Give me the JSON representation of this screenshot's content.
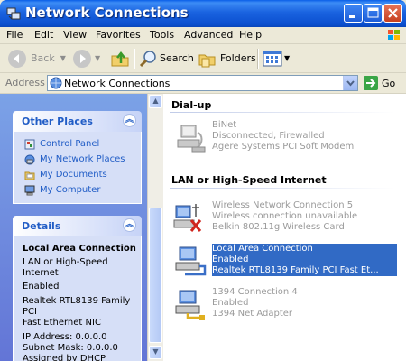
{
  "window": {
    "title": "Network Connections"
  },
  "menu": [
    "File",
    "Edit",
    "View",
    "Favorites",
    "Tools",
    "Advanced",
    "Help"
  ],
  "toolbar": {
    "back_label": "Back",
    "search_label": "Search",
    "folders_label": "Folders"
  },
  "address": {
    "label": "Address",
    "value": "Network Connections",
    "go_label": "Go"
  },
  "other_places": {
    "title": "Other Places",
    "links": [
      "Control Panel",
      "My Network Places",
      "My Documents",
      "My Computer"
    ]
  },
  "details": {
    "title": "Details",
    "name": "Local Area Connection",
    "lines": [
      "LAN or High-Speed Internet",
      "Enabled",
      "Realtek RTL8139 Family PCI",
      "Fast Ethernet NIC"
    ],
    "ip_lines": [
      "IP Address: 0.0.0.0",
      "Subnet Mask: 0.0.0.0",
      "Assigned by DHCP"
    ]
  },
  "groups": {
    "dialup": {
      "title": "Dial-up",
      "items": [
        {
          "name": "BiNet",
          "status": "Disconnected, Firewalled",
          "device": "Agere Systems PCI Soft Modem"
        }
      ]
    },
    "lan": {
      "title": "LAN or High-Speed Internet",
      "items": [
        {
          "name": "Wireless Network Connection 5",
          "status": "Wireless connection unavailable",
          "device": "Belkin 802.11g Wireless Card"
        },
        {
          "name": "Local Area Connection",
          "status": "Enabled",
          "device": "Realtek RTL8139 Family PCI Fast Et..."
        },
        {
          "name": "1394 Connection 4",
          "status": "Enabled",
          "device": "1394 Net Adapter"
        }
      ]
    }
  },
  "colors": {
    "titlebar": "#0A5FE8",
    "selection": "#316AC5",
    "task_link": "#215DC6",
    "pane_bg": "#7BA2E7"
  }
}
